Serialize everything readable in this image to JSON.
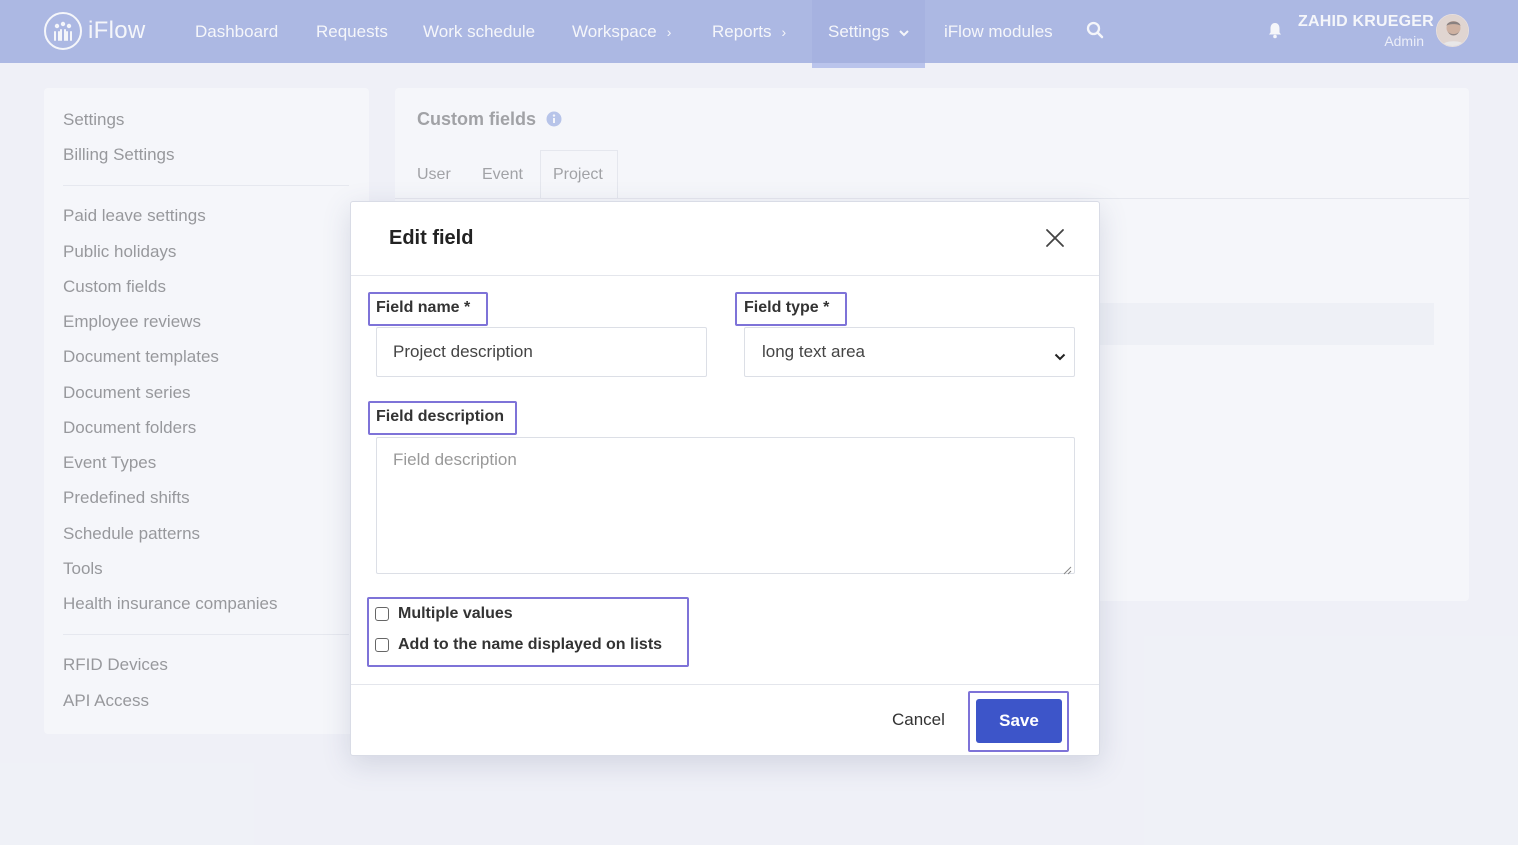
{
  "app": {
    "name": "iFlow"
  },
  "nav": {
    "items": [
      {
        "label": "Dashboard"
      },
      {
        "label": "Requests"
      },
      {
        "label": "Work schedule"
      },
      {
        "label": "Workspace"
      },
      {
        "label": "Reports"
      },
      {
        "label": "Settings"
      },
      {
        "label": "iFlow modules"
      }
    ],
    "active": "Settings"
  },
  "user": {
    "name": "ZAHID KRUEGER",
    "role": "Admin"
  },
  "sidebar": {
    "group1": [
      "Settings",
      "Billing Settings"
    ],
    "group2": [
      "Paid leave settings",
      "Public holidays",
      "Custom fields",
      "Employee reviews",
      "Document templates",
      "Document series",
      "Document folders",
      "Event Types",
      "Predefined shifts",
      "Schedule patterns",
      "Tools",
      "Health insurance companies"
    ],
    "group3": [
      "RFID Devices",
      "API Access"
    ]
  },
  "main": {
    "title": "Custom fields",
    "tabs": [
      "User",
      "Event",
      "Project"
    ],
    "active_tab": "Project"
  },
  "modal": {
    "title": "Edit field",
    "field_name_label": "Field name *",
    "field_name_value": "Project description",
    "field_type_label": "Field type *",
    "field_type_value": "long text area",
    "field_description_label": "Field description",
    "field_description_placeholder": "Field description",
    "checkbox_multiple": "Multiple values",
    "checkbox_add_name": "Add to the name displayed on lists",
    "cancel_label": "Cancel",
    "save_label": "Save"
  },
  "colors": {
    "topbar": "#7b8fd6",
    "highlight": "#7e73d8",
    "primary_button": "#3d55c9"
  }
}
